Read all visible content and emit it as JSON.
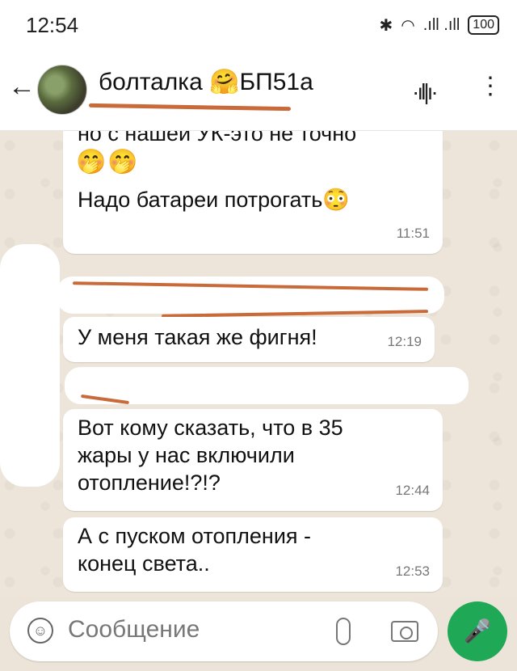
{
  "status_bar": {
    "time": "12:54",
    "battery": "100",
    "signal": ".ıll .ıll"
  },
  "header": {
    "title": "болталка 🤗БП51а",
    "back_icon": "←",
    "call_icon": "·ıl|ı·",
    "menu_icon": "⋮"
  },
  "messages": [
    {
      "partial_line": "но с нашей УК-это не точно",
      "emojis": "🤭🤭",
      "text": "Надо батареи потрогать😳",
      "time": "11:51"
    },
    {
      "text": "У меня такая же фигня!",
      "time": "12:19"
    },
    {
      "text": "Вот кому сказать, что в 35 жары у нас включили отопление!?!?",
      "time": "12:44"
    },
    {
      "text": "А с пуском отопления - конец света..",
      "time": "12:53"
    }
  ],
  "input": {
    "placeholder": "Сообщение",
    "emoji_icon": "☺",
    "mic_icon": "🎤"
  },
  "colors": {
    "accent": "#1fa855",
    "chat_bg": "#ede5d9",
    "bubble": "#ffffff",
    "redaction_marker": "#c96a3a"
  }
}
